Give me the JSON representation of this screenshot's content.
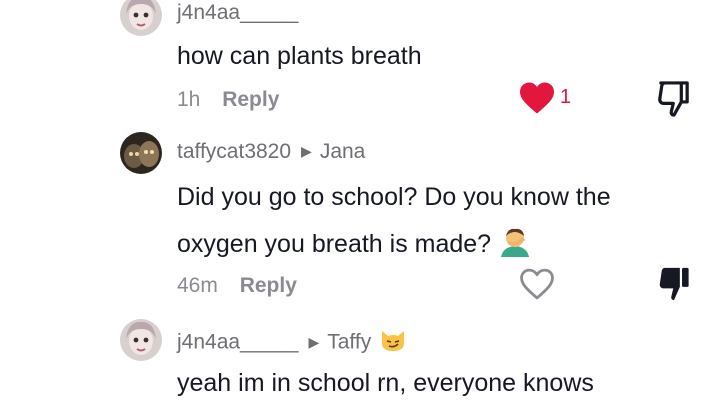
{
  "comments": [
    {
      "username": "j4n4aa_____",
      "text": "how can plants breath",
      "time": "1h",
      "reply_label": "Reply",
      "liked": true,
      "like_count": "1",
      "disliked": false
    },
    {
      "username": "taffycat3820",
      "reply_to": "Jana",
      "text_line1": "Did you go to school? Do you know the",
      "text_line2": "oxygen you breath is made?",
      "emoji": "man-facepalming",
      "time": "46m",
      "reply_label": "Reply",
      "liked": false,
      "disliked": true
    },
    {
      "username": "j4n4aa_____",
      "reply_to": "Taffy",
      "reply_to_emoji": "cat-smirk",
      "text": "yeah im in school rn, everyone knows"
    }
  ],
  "colors": {
    "like_red": "#e3163e",
    "text_dark": "#161823",
    "text_grey": "#8a8b91"
  }
}
